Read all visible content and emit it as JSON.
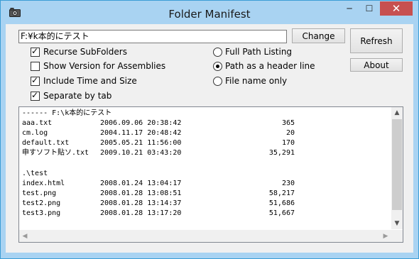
{
  "window": {
    "title": "Folder Manifest",
    "minimize_glyph": "─",
    "maximize_glyph": "☐",
    "close_glyph": "✕",
    "app_icon": "camera-icon"
  },
  "path": {
    "value": "F:¥k本的にテスト"
  },
  "buttons": {
    "change": "Change",
    "refresh": "Refresh",
    "about": "About"
  },
  "checkboxes": [
    {
      "label": "Recurse SubFolders",
      "checked": true
    },
    {
      "label": "Show Version for Assemblies",
      "checked": false
    },
    {
      "label": "Include Time and Size",
      "checked": true
    },
    {
      "label": "Separate by tab",
      "checked": true
    }
  ],
  "radios": [
    {
      "label": "Full Path Listing",
      "selected": false
    },
    {
      "label": "Path as a header line",
      "selected": true
    },
    {
      "label": "File name only",
      "selected": false
    }
  ],
  "output": {
    "header": "------ F:\\k本的にテスト",
    "folder1_files": [
      {
        "name": "aaa.txt",
        "datetime": "2006.09.06 20:38:42",
        "size": "365"
      },
      {
        "name": "cm.log",
        "datetime": "2004.11.17 20:48:42",
        "size": "20"
      },
      {
        "name": "default.txt",
        "datetime": "2005.05.21 11:56:00",
        "size": "170"
      },
      {
        "name": "申すソフト貼ソ.txt",
        "datetime": "2009.10.21 03:43:20",
        "size": "35,291"
      }
    ],
    "subfolder": ".\\test",
    "folder2_files": [
      {
        "name": "index.html",
        "datetime": "2008.01.24 13:04:17",
        "size": "230"
      },
      {
        "name": "test.png",
        "datetime": "2008.01.28 13:08:51",
        "size": "58,217"
      },
      {
        "name": "test2.png",
        "datetime": "2008.01.28 13:14:37",
        "size": "51,686"
      },
      {
        "name": "test3.png",
        "datetime": "2008.01.28 13:17:20",
        "size": "51,667"
      }
    ]
  },
  "scrollbar_glyphs": {
    "up": "▲",
    "down": "▼",
    "left": "◀",
    "right": "▶"
  }
}
